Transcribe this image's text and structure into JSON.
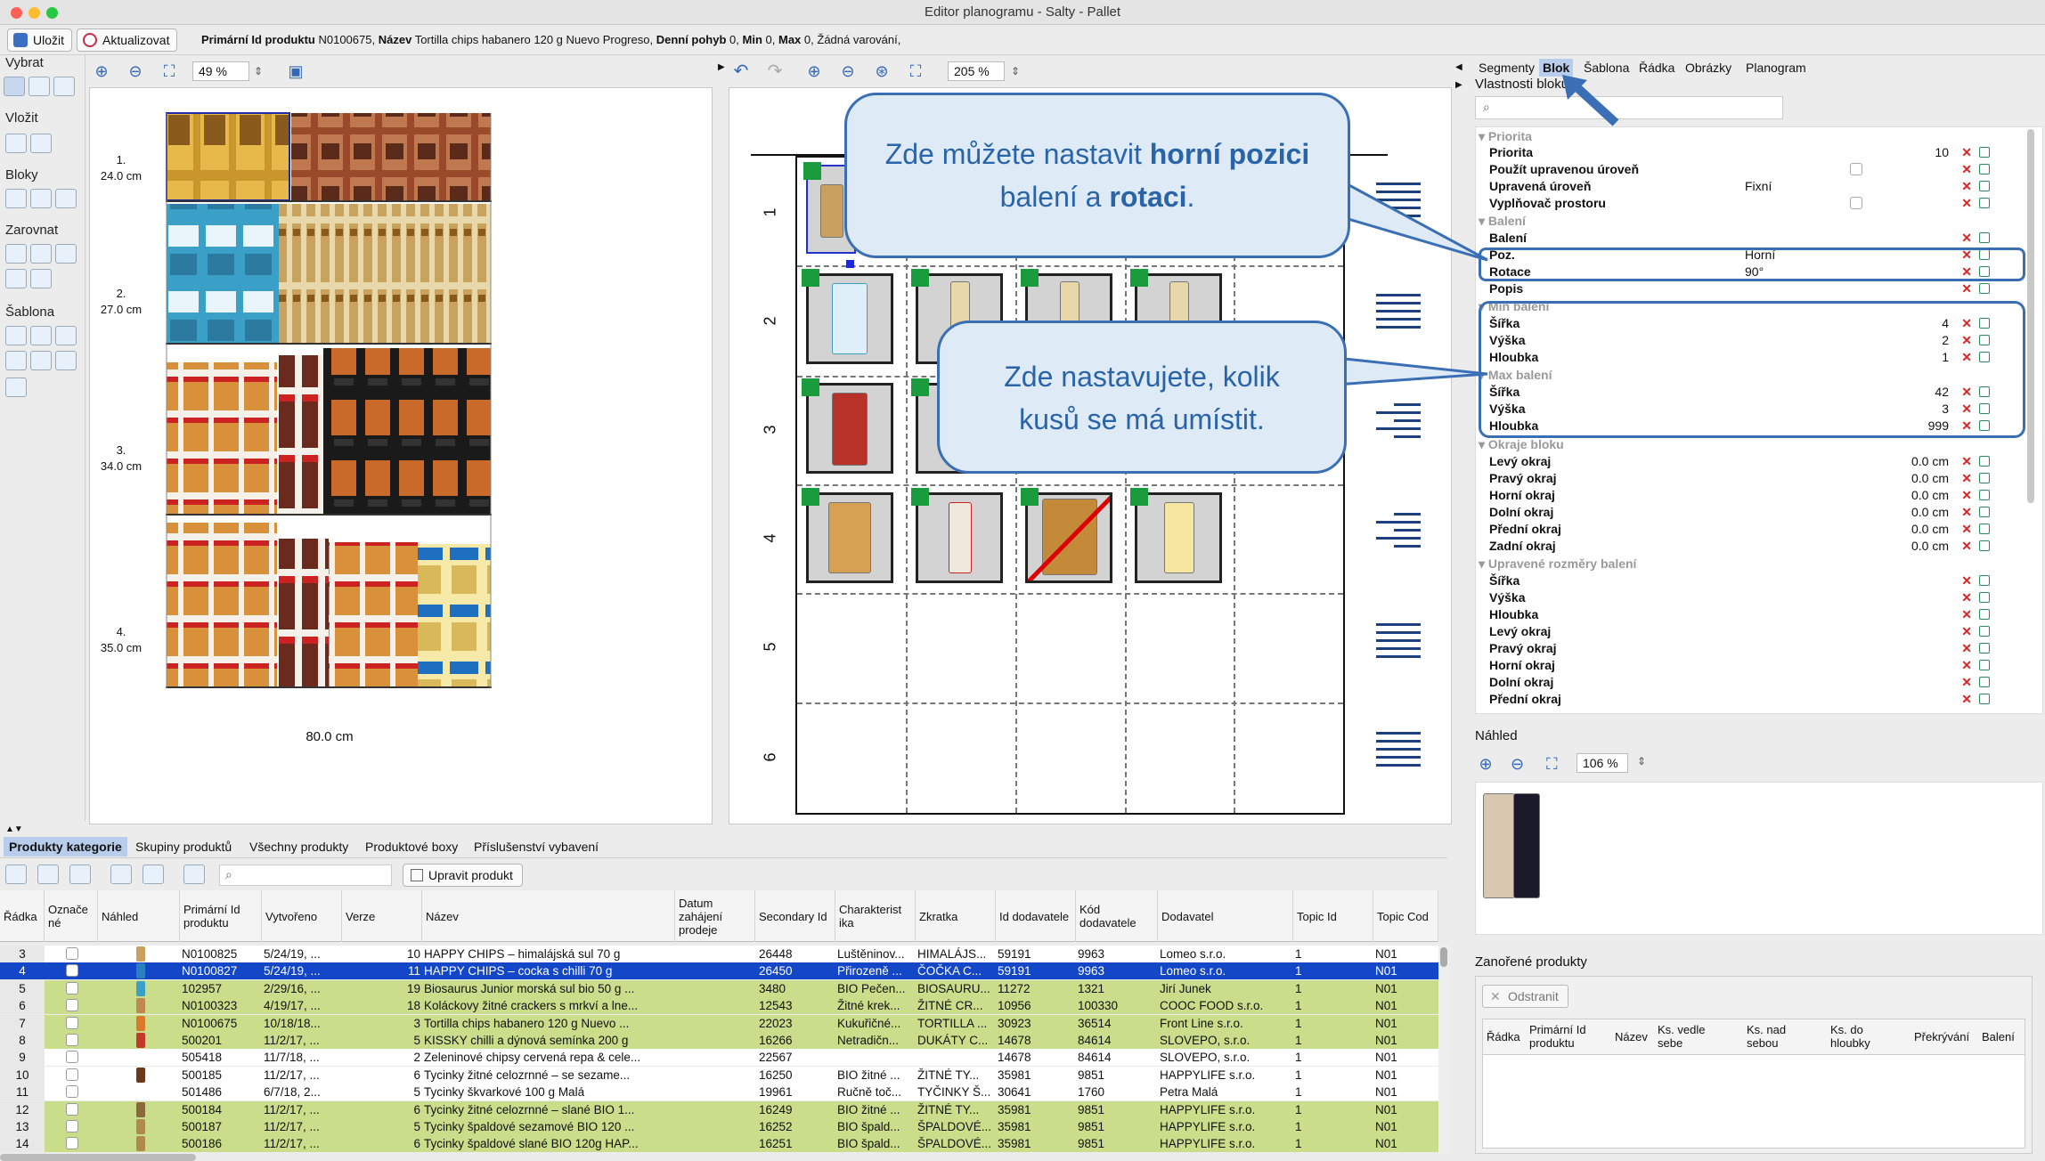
{
  "window": {
    "title": "Editor planogramu - Salty - Pallet"
  },
  "toolbar": {
    "save_label": "Uložit",
    "update_label": "Aktualizovat",
    "info": {
      "pid_label": "Primární Id produktu",
      "pid": "N0100675,",
      "name_label": "Název",
      "name": "Tortilla chips habanero 120 g Nuevo Progreso,",
      "mov_label": "Denní pohyb",
      "mov": "0,",
      "min_label": "Min",
      "min": "0,",
      "max_label": "Max",
      "max": "0,",
      "warn": "Žádná varování,"
    }
  },
  "tools": {
    "select": "Vybrat",
    "insert": "Vložit",
    "blocks": "Bloky",
    "align": "Zarovnat",
    "template": "Šablona"
  },
  "left_view": {
    "zoom": "49 %",
    "rows": [
      {
        "num": "1.",
        "height": "24.0 cm"
      },
      {
        "num": "2.",
        "height": "27.0 cm"
      },
      {
        "num": "3.",
        "height": "34.0 cm"
      },
      {
        "num": "4.",
        "height": "35.0 cm"
      }
    ],
    "width_label": "80.0 cm"
  },
  "block_view": {
    "zoom": "205 %",
    "slots": [
      "1",
      "2",
      "3",
      "4",
      "5",
      "6"
    ]
  },
  "callouts": {
    "top": {
      "pre": "Zde můžete nastavit ",
      "b1": "horní pozici",
      "mid": " balení a ",
      "b2": "rotaci",
      "post": "."
    },
    "bottom": {
      "line1": "Zde nastavujete, kolik",
      "line2": "kusů se má umístit."
    }
  },
  "right_panel": {
    "tabs": [
      "Segmenty",
      "Blok",
      "Šablona",
      "Řádka",
      "Obrázky",
      "Planogram"
    ],
    "active_tab": "Blok",
    "section_title": "Vlastnosti bloku",
    "groups": {
      "priority": "Priorita",
      "packing": "Balení",
      "min_pack": "Min balení",
      "max_pack": "Max balení",
      "edges": "Okraje bloku",
      "adjusted": "Upravené rozměry balení"
    },
    "props": {
      "priorita": {
        "label": "Priorita",
        "value": "10"
      },
      "pouzit": {
        "label": "Použít upravenou úroveň"
      },
      "upravena": {
        "label": "Upravená úroveň",
        "value": "Fixní"
      },
      "vyplnovac": {
        "label": "Vyplňovač prostoru"
      },
      "baleni": {
        "label": "Balení"
      },
      "poz": {
        "label": "Poz.",
        "value": "Horní"
      },
      "rotace": {
        "label": "Rotace",
        "value": "90°"
      },
      "popis": {
        "label": "Popis"
      },
      "min_sirka": {
        "label": "Šířka",
        "value": "4"
      },
      "min_vyska": {
        "label": "Výška",
        "value": "2"
      },
      "min_hloubka": {
        "label": "Hloubka",
        "value": "1"
      },
      "max_sirka": {
        "label": "Šířka",
        "value": "42"
      },
      "max_vyska": {
        "label": "Výška",
        "value": "3"
      },
      "max_hloubka": {
        "label": "Hloubka",
        "value": "999"
      },
      "levy": {
        "label": "Levý okraj",
        "value": "0.0 cm"
      },
      "pravy": {
        "label": "Pravý okraj",
        "value": "0.0 cm"
      },
      "horni": {
        "label": "Horní okraj",
        "value": "0.0 cm"
      },
      "dolni": {
        "label": "Dolní okraj",
        "value": "0.0 cm"
      },
      "predni": {
        "label": "Přední okraj",
        "value": "0.0 cm"
      },
      "zadni": {
        "label": "Zadní okraj",
        "value": "0.0 cm"
      },
      "a_sirka": {
        "label": "Šířka"
      },
      "a_vyska": {
        "label": "Výška"
      },
      "a_hloubka": {
        "label": "Hloubka"
      },
      "a_levy": {
        "label": "Levý okraj"
      },
      "a_pravy": {
        "label": "Pravý okraj"
      },
      "a_horni": {
        "label": "Horní okraj"
      },
      "a_dolni": {
        "label": "Dolní okraj"
      },
      "a_predni": {
        "label": "Přední okraj"
      }
    },
    "preview": {
      "title": "Náhled",
      "zoom": "106 %"
    },
    "nested": {
      "title": "Zanořené produkty",
      "remove_label": "Odstranit",
      "columns": [
        "Řádka",
        "Primární Id produktu",
        "Název",
        "Ks. vedle sebe",
        "Ks. nad sebou",
        "Ks. do hloubky",
        "Překrývání",
        "Balení"
      ]
    }
  },
  "bottom": {
    "tabs": [
      "Produkty kategorie",
      "Skupiny produktů",
      "Všechny produkty",
      "Produktové boxy",
      "Příslušenství vybavení"
    ],
    "edit_product_label": "Upravit produkt",
    "columns": [
      "Řádka",
      "Označe né",
      "Náhled",
      "Primární Id produktu",
      "Vytvořeno",
      "Verze",
      "Název",
      "Datum zahájení prodeje",
      "Secondary Id",
      "Charakterist ika",
      "Zkratka",
      "Id dodavatele",
      "Kód dodavatele",
      "Dodavatel",
      "Topic Id",
      "Topic Cod"
    ],
    "rows": [
      {
        "row": "3",
        "pid": "N0100825",
        "created": "5/24/19, ...",
        "ver": "10",
        "name": "HAPPY CHIPS – himalájská sul 70 g",
        "sec": "26448",
        "char": "Luštěninov...",
        "abbr": "HIMALÁJS...",
        "sup_id": "59191",
        "sup_code": "9963",
        "supplier": "Lomeo s.r.o.",
        "topic_id": "1",
        "topic_code": "N01",
        "style": "w"
      },
      {
        "row": "4",
        "pid": "N0100827",
        "created": "5/24/19, ...",
        "ver": "11",
        "name": "HAPPY CHIPS – cocka s chilli 70 g",
        "sec": "26450",
        "char": "Přirozeně ...",
        "abbr": "ČOČKA C...",
        "sup_id": "59191",
        "sup_code": "9963",
        "supplier": "Lomeo s.r.o.",
        "topic_id": "1",
        "topic_code": "N01",
        "style": "s"
      },
      {
        "row": "5",
        "pid": "102957",
        "created": "2/29/16, ...",
        "ver": "19",
        "name": "Biosaurus Junior morská sul bio 50 g ...",
        "sec": "3480",
        "char": "BIO Pečen...",
        "abbr": "BIOSAURU...",
        "sup_id": "11272",
        "sup_code": "1321",
        "supplier": "Jirí Junek",
        "topic_id": "1",
        "topic_code": "N01",
        "style": "g"
      },
      {
        "row": "6",
        "pid": "N0100323",
        "created": "4/19/17, ...",
        "ver": "18",
        "name": "Koláckovy žitné crackers s mrkví a lne...",
        "sec": "12543",
        "char": "Žitné krek...",
        "abbr": "ŽITNÉ CR...",
        "sup_id": "10956",
        "sup_code": "100330",
        "supplier": "COOC FOOD s.r.o.",
        "topic_id": "1",
        "topic_code": "N01",
        "style": "g"
      },
      {
        "row": "7",
        "pid": "N0100675",
        "created": "10/18/18...",
        "ver": "3",
        "name": "Tortilla chips habanero 120 g Nuevo ...",
        "sec": "22023",
        "char": "Kukuřičné...",
        "abbr": "TORTILLA ...",
        "sup_id": "30923",
        "sup_code": "36514",
        "supplier": "Front Line s.r.o.",
        "topic_id": "1",
        "topic_code": "N01",
        "style": "g"
      },
      {
        "row": "8",
        "pid": "500201",
        "created": "11/2/17, ...",
        "ver": "5",
        "name": "KISSKY chilli a dýnová semínka 200 g",
        "sec": "16266",
        "char": "Netradičn...",
        "abbr": "DUKÁTY C...",
        "sup_id": "14678",
        "sup_code": "84614",
        "supplier": "SLOVEPO, s.r.o.",
        "topic_id": "1",
        "topic_code": "N01",
        "style": "g"
      },
      {
        "row": "9",
        "pid": "505418",
        "created": "11/7/18, ...",
        "ver": "2",
        "name": "Zeleninové chipsy cervená repa & cele...",
        "sec": "22567",
        "char": "",
        "abbr": "",
        "sup_id": "14678",
        "sup_code": "84614",
        "supplier": "SLOVEPO, s.r.o.",
        "topic_id": "1",
        "topic_code": "N01",
        "style": "w"
      },
      {
        "row": "10",
        "pid": "500185",
        "created": "11/2/17, ...",
        "ver": "6",
        "name": "Tycinky žitné celozrnné – se sezame...",
        "sec": "16250",
        "char": "BIO žitné ...",
        "abbr": "ŽITNÉ TY...",
        "sup_id": "35981",
        "sup_code": "9851",
        "supplier": "HAPPYLIFE s.r.o.",
        "topic_id": "1",
        "topic_code": "N01",
        "style": "w"
      },
      {
        "row": "11",
        "pid": "501486",
        "created": "6/7/18, 2...",
        "ver": "5",
        "name": "Tycinky škvarkové 100 g Malá",
        "sec": "19961",
        "char": "Ručně toč...",
        "abbr": "TYČINKY Š...",
        "sup_id": "30641",
        "sup_code": "1760",
        "supplier": "Petra Malá",
        "topic_id": "1",
        "topic_code": "N01",
        "style": "w"
      },
      {
        "row": "12",
        "pid": "500184",
        "created": "11/2/17, ...",
        "ver": "6",
        "name": "Tycinky žitné celozrnné – slané BIO 1...",
        "sec": "16249",
        "char": "BIO žitné ...",
        "abbr": "ŽITNÉ TY...",
        "sup_id": "35981",
        "sup_code": "9851",
        "supplier": "HAPPYLIFE s.r.o.",
        "topic_id": "1",
        "topic_code": "N01",
        "style": "g"
      },
      {
        "row": "13",
        "pid": "500187",
        "created": "11/2/17, ...",
        "ver": "5",
        "name": "Tycinky špaldové sezamové BIO 120 ...",
        "sec": "16252",
        "char": "BIO špald...",
        "abbr": "ŠPALDOVÉ...",
        "sup_id": "35981",
        "sup_code": "9851",
        "supplier": "HAPPYLIFE s.r.o.",
        "topic_id": "1",
        "topic_code": "N01",
        "style": "g"
      },
      {
        "row": "14",
        "pid": "500186",
        "created": "11/2/17, ...",
        "ver": "6",
        "name": "Tycinky špaldové slané BIO 120g HAP...",
        "sec": "16251",
        "char": "BIO špald...",
        "abbr": "ŠPALDOVÉ...",
        "sup_id": "35981",
        "sup_code": "9851",
        "supplier": "HAPPYLIFE s.r.o.",
        "topic_id": "1",
        "topic_code": "N01",
        "style": "g"
      }
    ]
  },
  "colors": {
    "accent": "#1447c8",
    "row_green": "#c9dd8a",
    "callout_border": "#3a6fb5",
    "callout_text": "#2a64a8",
    "block_green": "#1a9c3e"
  }
}
